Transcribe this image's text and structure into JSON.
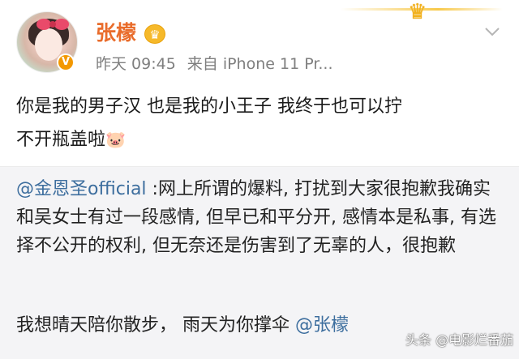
{
  "user": {
    "name": "张檬",
    "verified_badge": "V",
    "vip_icon": "crown-icon",
    "avatar_icon": "avatar-photo"
  },
  "meta": {
    "time": "昨天 09:45",
    "source_label": "来自",
    "source": "iPhone 11 Pr..."
  },
  "post": {
    "line1": "你是我的男子汉  也是我的小王子  我终于也可以拧",
    "line2": "不开瓶盖啦",
    "emoji": "🐷"
  },
  "repost": {
    "mention": "@金恩圣official",
    "text": " :网上所谓的爆料, 打扰到大家很抱歉我确实和吴女士有过一段感情, 但早已和平分开, 感情本是私事, 有选择不公开的权利, 但无奈还是伤害到了无辜的人，很抱歉",
    "reply_text": "我想晴天陪你散步，  雨天为你撑伞 ",
    "reply_mention": "@张檬"
  },
  "watermark": "头条 @电影烂番茄",
  "colors": {
    "username": "#e96c2b",
    "mention": "#3d6e9e",
    "meta": "#7f7f7f",
    "repost_bg": "#f4f4f6",
    "verified": "#f39800",
    "crown": "#f6b92a"
  }
}
